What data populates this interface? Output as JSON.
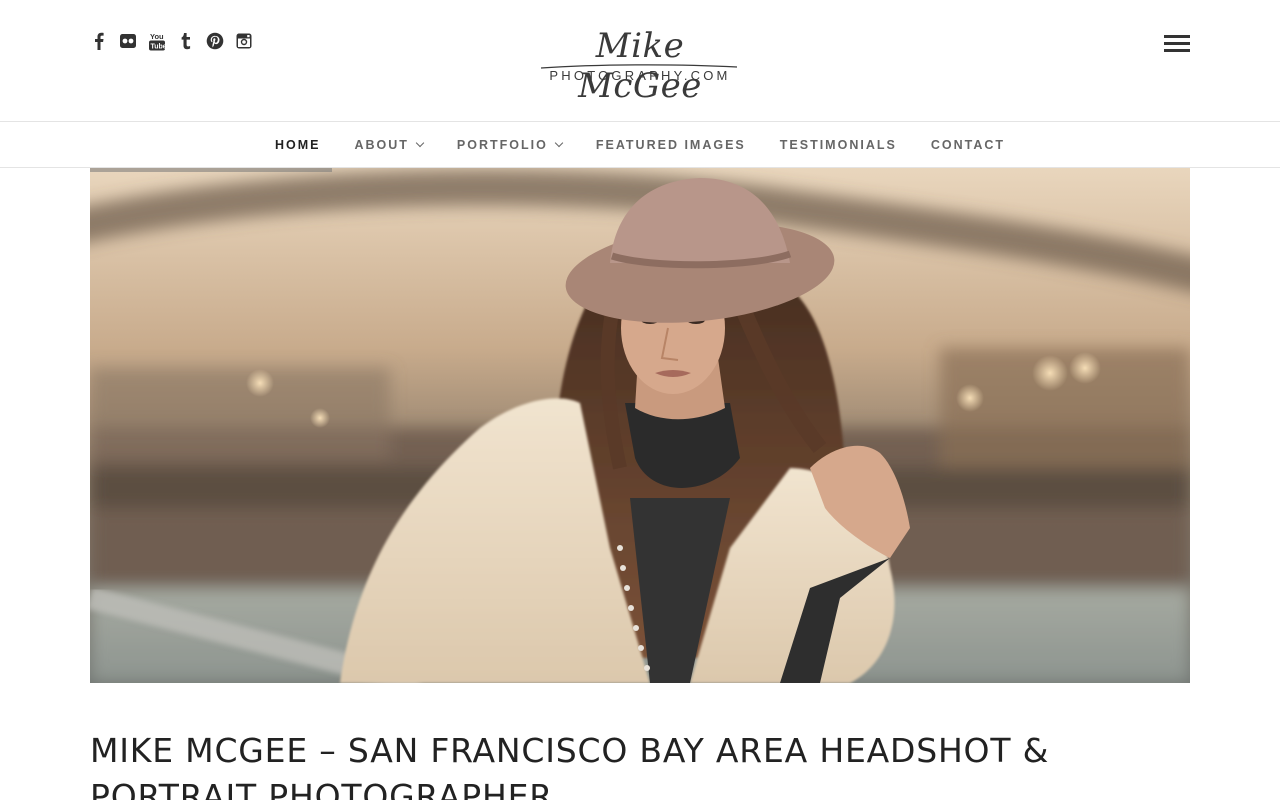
{
  "social": [
    {
      "name": "facebook-icon"
    },
    {
      "name": "flickr-icon"
    },
    {
      "name": "youtube-icon"
    },
    {
      "name": "tumblr-icon"
    },
    {
      "name": "pinterest-icon"
    },
    {
      "name": "instagram-icon"
    }
  ],
  "logo": {
    "script_text": "Mike McGee",
    "sub_text": "PHOTOGRAPHY.COM"
  },
  "nav": {
    "items": [
      {
        "label": "HOME",
        "active": true,
        "dropdown": false
      },
      {
        "label": "ABOUT",
        "active": false,
        "dropdown": true
      },
      {
        "label": "PORTFOLIO",
        "active": false,
        "dropdown": true
      },
      {
        "label": "FEATURED IMAGES",
        "active": false,
        "dropdown": false
      },
      {
        "label": "TESTIMONIALS",
        "active": false,
        "dropdown": false
      },
      {
        "label": "CONTACT",
        "active": false,
        "dropdown": false
      }
    ]
  },
  "slider": {
    "progress": 0.22
  },
  "page": {
    "title": "MIKE MCGEE – SAN FRANCISCO BAY AREA HEADSHOT & PORTRAIT PHOTOGRAPHER"
  },
  "colors": {
    "text": "#222222",
    "nav_text": "#666666",
    "divider": "#e4e4e4"
  }
}
